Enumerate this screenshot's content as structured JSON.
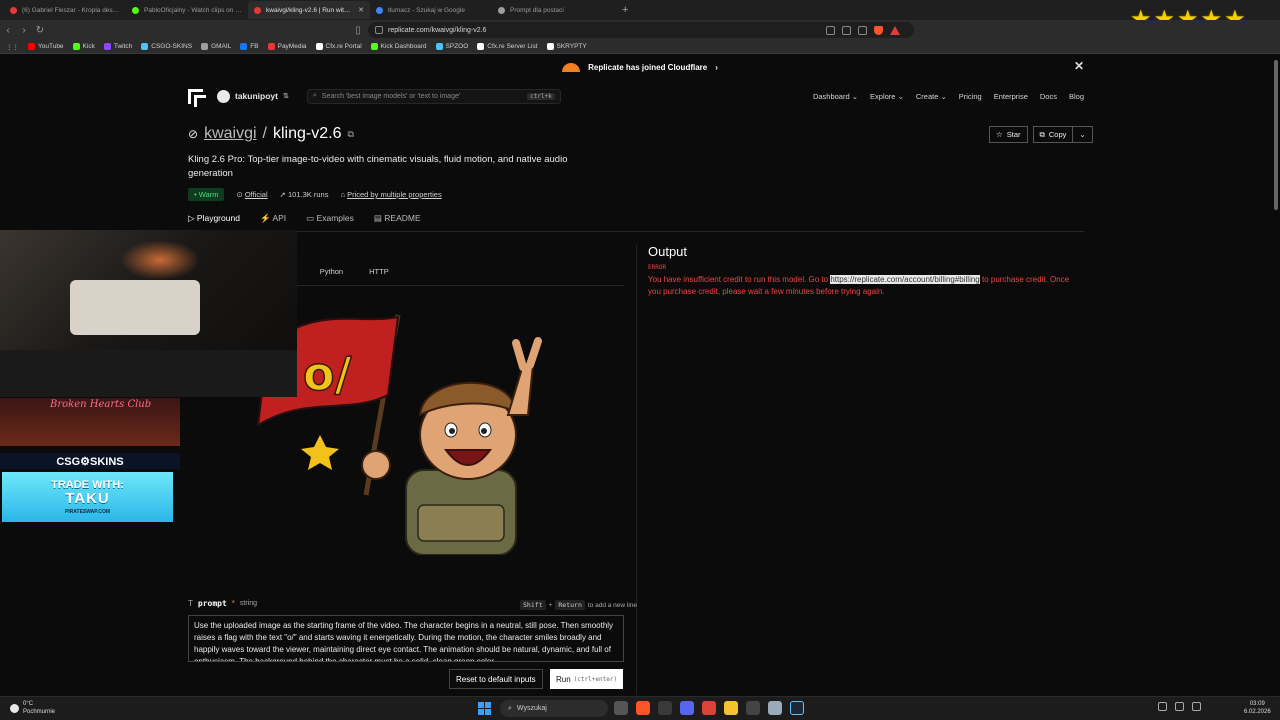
{
  "browser": {
    "tabs": [
      {
        "title": "(6) Gabriel Fleszar - Kropla deszczu (",
        "color": "#e53935",
        "active": false
      },
      {
        "title": "PabloOficjalny - Watch clips on Kick",
        "color": "#53fc18",
        "active": false
      },
      {
        "title": "kwaivgi/kling-v2.6 | Run with an API",
        "color": "#e53935",
        "active": true
      },
      {
        "title": "tłumacz - Szukaj w Google",
        "color": "#4285f4",
        "active": false
      },
      {
        "title": "Prompt dla postaci",
        "color": "#9e9e9e",
        "active": false
      }
    ],
    "url": "replicate.com/kwaivgi/kling-v2.6",
    "bookmarks": [
      {
        "label": "YouTube",
        "color": "#ff0000"
      },
      {
        "label": "Kick",
        "color": "#53fc18"
      },
      {
        "label": "Twitch",
        "color": "#9146ff"
      },
      {
        "label": "CSGO-SKINS",
        "color": "#4fc3f7"
      },
      {
        "label": "GMAIL",
        "color": "#9e9e9e"
      },
      {
        "label": "FB",
        "color": "#1877f2"
      },
      {
        "label": "PayMedia",
        "color": "#e53935"
      },
      {
        "label": "Cfx.re Portal",
        "color": "#ffffff"
      },
      {
        "label": "Kick Dashboard",
        "color": "#53fc18"
      },
      {
        "label": "SPZOO",
        "color": "#4fc3f7"
      },
      {
        "label": "Cfx.re Server List",
        "color": "#ffffff"
      },
      {
        "label": "SKRYPTY",
        "color": "#ffffff"
      }
    ],
    "stars_count": 5
  },
  "banner": {
    "text": "Replicate has joined Cloudflare",
    "arrow": "›"
  },
  "navbar": {
    "username": "takunipoyt",
    "search_placeholder": "Search 'best image models' or 'text to image'",
    "search_shortcut": "ctrl+k",
    "links": [
      "Dashboard",
      "Explore",
      "Create",
      "Pricing",
      "Enterprise",
      "Docs",
      "Blog"
    ]
  },
  "model": {
    "owner": "kwaivgi",
    "slash": "/",
    "name": "kling-v2.6",
    "star_label": "Star",
    "copy_label": "Copy",
    "description": "Kling 2.6 Pro: Top-tier image-to-video with cinematic visuals, fluid motion, and native audio generation",
    "status": "Warm",
    "official": "Official",
    "runs": "101.3K runs",
    "pricing": "Priced by multiple properties"
  },
  "tabs": [
    "Playground",
    "API",
    "Examples",
    "README"
  ],
  "subtabs": [
    "s",
    "Python",
    "HTTP"
  ],
  "prompt": {
    "label": "prompt",
    "required": "*",
    "type": "string",
    "hint_key1": "Shift",
    "hint_plus": "+",
    "hint_key2": "Return",
    "hint_text": "to add a new line",
    "value": "Use the uploaded image as the starting frame of the video. The character begins in a neutral, still pose. Then smoothly raises a flag with the text \"o/\" and starts waving it energetically. During the motion, the character smiles broadly and happily waves toward the viewer, maintaining direct eye contact. The animation should be natural, dynamic, and full of enthusiasm. The background behind the character must be a solid, clean green color."
  },
  "buttons": {
    "reset": "Reset to default inputs",
    "run": "Run",
    "run_shortcut": "(ctrl+enter)"
  },
  "output": {
    "title": "Output",
    "error_label": "ERROR",
    "error_before": "You have insufficient credit to run this model. Go to ",
    "error_link": "https://replicate.com/account/billing#billing",
    "error_after": " to purchase credit. Once you purchase credit, please wait a few minutes before trying again."
  },
  "overlay": {
    "club_title": "Broken Hearts Club",
    "csgo": "CSG⚙SKINS",
    "trade_line1": "TRADE WITH:",
    "trade_line2": "TAKU",
    "trade_site": "PIRATESWAP.COM"
  },
  "taskbar": {
    "temperature": "0°C",
    "weather": "Pochmurnie",
    "search": "Wyszukaj",
    "time": "03:09",
    "date": "6.02.2026"
  }
}
